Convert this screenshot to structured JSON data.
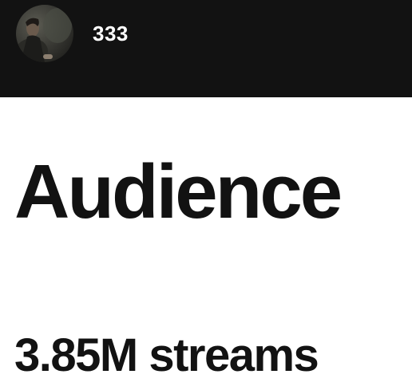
{
  "header": {
    "artist_name": "333",
    "avatar_icon": "artist-avatar-photo"
  },
  "main": {
    "title": "Audience",
    "streams_value": "3.85M",
    "streams_unit": "streams"
  },
  "colors": {
    "header_background": "#121212",
    "page_background": "#ffffff",
    "text_dark": "#121212",
    "text_light": "#ffffff"
  }
}
